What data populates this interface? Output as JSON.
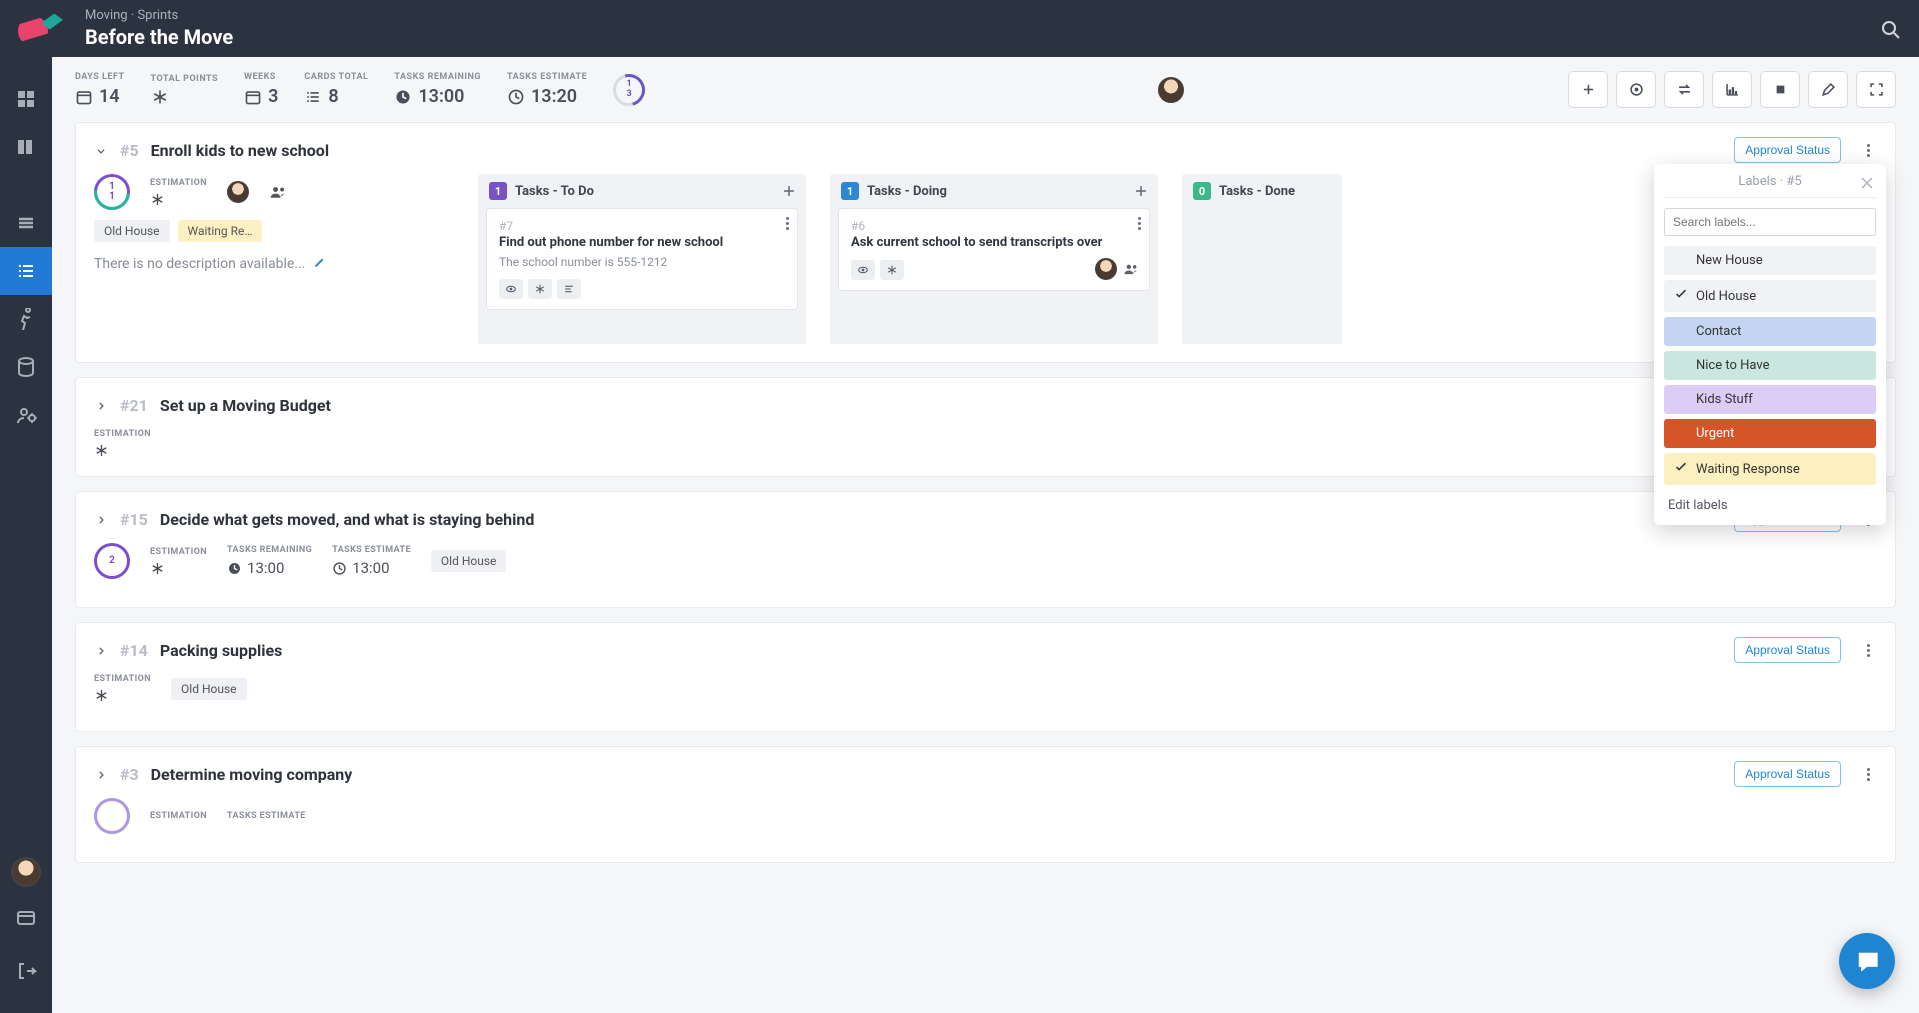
{
  "header": {
    "breadcrumb": "Moving · Sprints",
    "title": "Before the Move"
  },
  "stats": {
    "days_left": {
      "label": "DAYS LEFT",
      "value": "14"
    },
    "total_points": {
      "label": "TOTAL POINTS"
    },
    "weeks": {
      "label": "WEEKS",
      "value": "3"
    },
    "cards_total": {
      "label": "CARDS TOTAL",
      "value": "8"
    },
    "tasks_remaining": {
      "label": "TASKS REMAINING",
      "value": "13:00"
    },
    "tasks_estimate": {
      "label": "TASKS ESTIMATE",
      "value": "13:20"
    },
    "dial": {
      "top": "1",
      "bottom": "3"
    }
  },
  "section5": {
    "num": "#5",
    "title": "Enroll kids to new school",
    "approval_status": "Approval Status",
    "ring": {
      "top": "1",
      "bottom": "1"
    },
    "estimation_label": "ESTIMATION",
    "chip1": "Old House",
    "chip2": "Waiting Re…",
    "empty_desc": "There is no description available...",
    "lane_todo": {
      "count": "1",
      "title": "Tasks - To Do"
    },
    "lane_doing": {
      "count": "1",
      "title": "Tasks - Doing"
    },
    "lane_done": {
      "count": "0",
      "title": "Tasks - Done"
    },
    "task7": {
      "num": "#7",
      "title": "Find out phone number for new school",
      "desc": "The school number is 555-1212"
    },
    "task6": {
      "num": "#6",
      "title": "Ask current school to send transcripts over"
    }
  },
  "section21": {
    "num": "#21",
    "title": "Set up a Moving Budget",
    "estimation_label": "ESTIMATION"
  },
  "section15": {
    "num": "#15",
    "title": "Decide what gets moved, and what is staying behind",
    "approval_status": "Approval Status",
    "ring": "2",
    "estimation_label": "ESTIMATION",
    "tasks_remaining_label": "TASKS REMAINING",
    "tasks_remaining_value": "13:00",
    "tasks_estimate_label": "TASKS ESTIMATE",
    "tasks_estimate_value": "13:00",
    "chip": "Old House"
  },
  "section14": {
    "num": "#14",
    "title": "Packing supplies",
    "approval_status": "Approval Status",
    "estimation_label": "ESTIMATION",
    "chip": "Old House"
  },
  "section3": {
    "num": "#3",
    "title": "Determine moving company",
    "approval_status": "Approval Status",
    "estimation_label": "ESTIMATION",
    "tasks_estimate_label": "TASKS ESTIMATE"
  },
  "popover": {
    "title": "Labels · #5",
    "search_placeholder": "Search labels...",
    "labels": {
      "new_house": "New House",
      "old_house": "Old House",
      "contact": "Contact",
      "nice_to_have": "Nice to Have",
      "kids_stuff": "Kids Stuff",
      "urgent": "Urgent",
      "waiting_response": "Waiting Response"
    },
    "edit": "Edit labels"
  }
}
